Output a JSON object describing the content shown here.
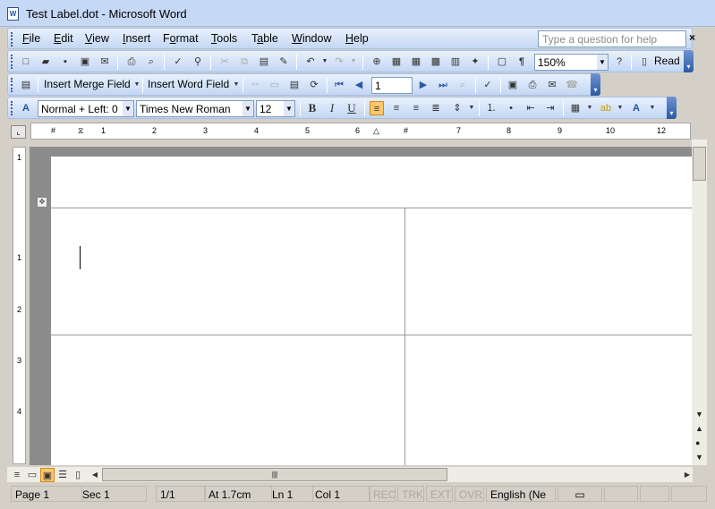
{
  "window": {
    "title": "Test Label.dot - Microsoft Word",
    "icon": "word-doc-icon"
  },
  "menu": {
    "items": [
      {
        "label": "File",
        "key": "F"
      },
      {
        "label": "Edit",
        "key": "E"
      },
      {
        "label": "View",
        "key": "V"
      },
      {
        "label": "Insert",
        "key": "I"
      },
      {
        "label": "Format",
        "key": "o"
      },
      {
        "label": "Tools",
        "key": "T"
      },
      {
        "label": "Table",
        "key": "a"
      },
      {
        "label": "Window",
        "key": "W"
      },
      {
        "label": "Help",
        "key": "H"
      }
    ],
    "ask_placeholder": "Type a question for help",
    "close_label": "×"
  },
  "standard": {
    "zoom": "150%",
    "read_label": "Read"
  },
  "mailmerge": {
    "insert_merge_field": "Insert Merge Field",
    "insert_word_field": "Insert Word Field",
    "record": "1"
  },
  "formatting": {
    "style": "Normal + Left: 0",
    "font": "Times New Roman",
    "size": "12"
  },
  "ruler": {
    "h_numbers": [
      "1",
      "1",
      "2",
      "3",
      "4",
      "5",
      "6",
      "7",
      "8",
      "9",
      "10",
      "11",
      "12"
    ],
    "v_numbers": [
      "1",
      "1",
      "2",
      "3",
      "4"
    ]
  },
  "status": {
    "page": "Page 1",
    "sec": "Sec 1",
    "pages": "1/1",
    "at": "At 1.7cm",
    "ln": "Ln 1",
    "col": "Col 1",
    "rec": "REC",
    "trk": "TRK",
    "ext": "EXT",
    "ovr": "OVR",
    "lang": "English (Ne"
  },
  "colors": {
    "accent": "#ffc76a",
    "toolbar": "#c3d7f4",
    "workspace": "#8c8c8c"
  }
}
